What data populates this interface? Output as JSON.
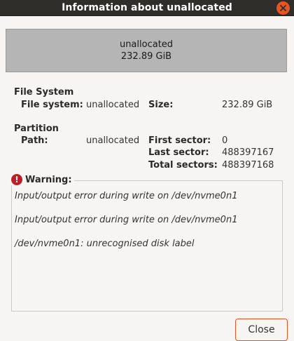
{
  "window": {
    "title": "Information about unallocated"
  },
  "partition_graphic": {
    "name": "unallocated",
    "size": "232.89 GiB"
  },
  "file_system_section": {
    "heading": "File System",
    "file_system_label": "File system:",
    "file_system_value": "unallocated",
    "size_label": "Size:",
    "size_value": "232.89 GiB"
  },
  "partition_section": {
    "heading": "Partition",
    "path_label": "Path:",
    "path_value": "unallocated",
    "first_sector_label": "First sector:",
    "first_sector_value": "0",
    "last_sector_label": "Last sector:",
    "last_sector_value": "488397167",
    "total_sectors_label": "Total sectors:",
    "total_sectors_value": "488397168"
  },
  "warning": {
    "title": "Warning:",
    "messages": [
      "Input/output error during write on /dev/nvme0n1",
      "Input/output error during write on /dev/nvme0n1",
      "/dev/nvme0n1: unrecognised disk label"
    ]
  },
  "footer": {
    "close_label": "Close"
  },
  "colors": {
    "accent": "#e95420",
    "titlebar": "#2f2e2b",
    "partition_fill": "#b5b5b5",
    "warning_icon": "#c01c28"
  }
}
